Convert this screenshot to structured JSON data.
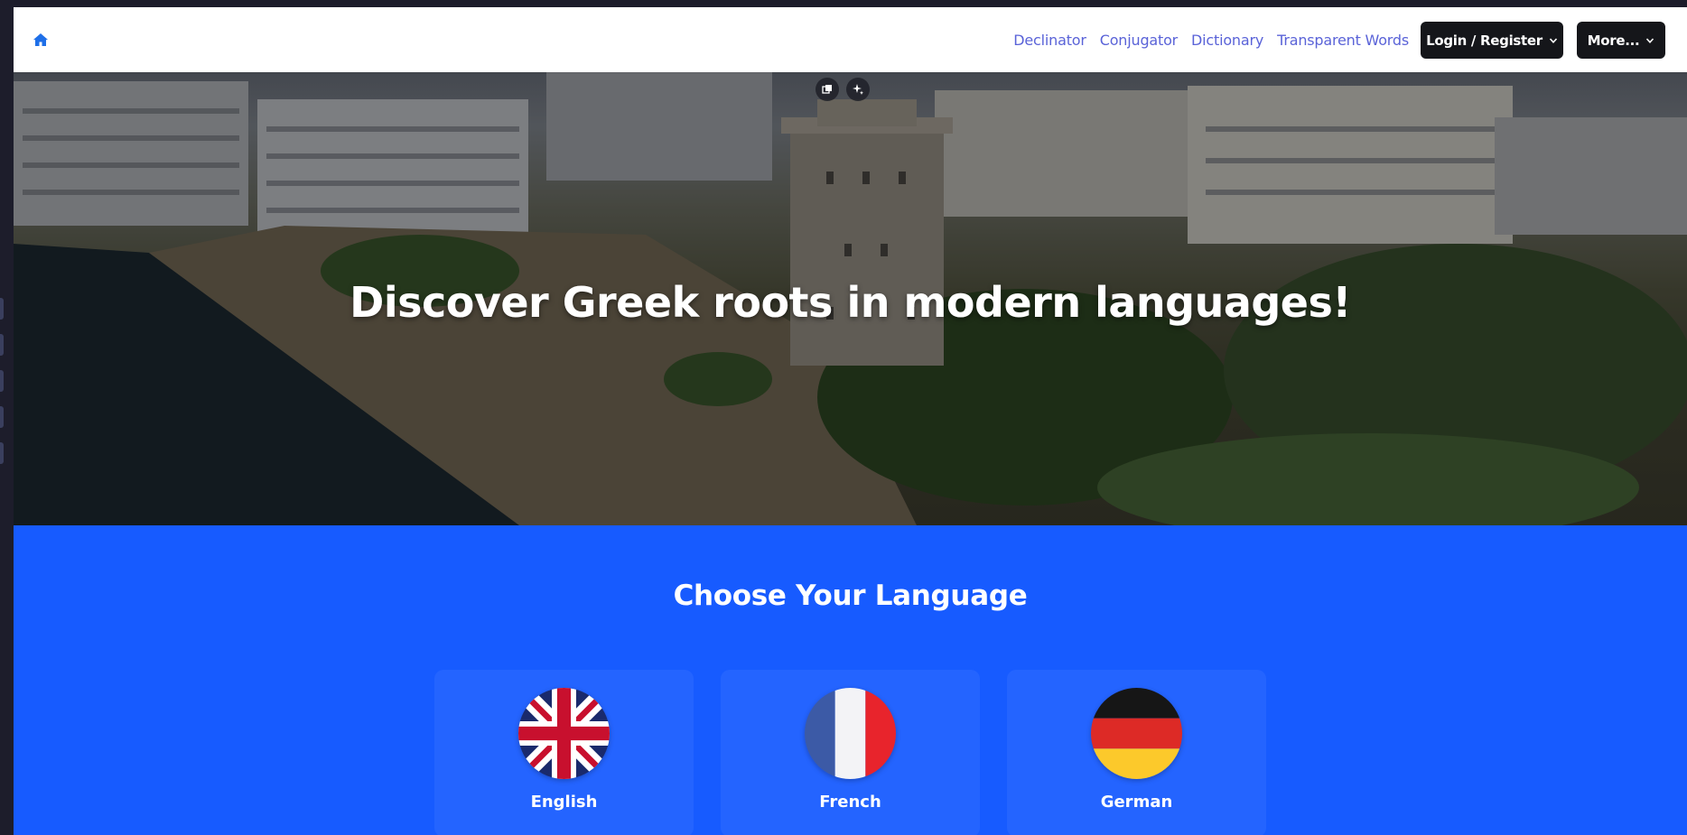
{
  "nav": {
    "home_icon": "home-icon",
    "links": [
      "Declinator",
      "Conjugator",
      "Dictionary",
      "Transparent Words"
    ],
    "login_label": "Login / Register",
    "more_label": "More...",
    "link_color": "#5a63d8",
    "button_color": "#15161a"
  },
  "hero": {
    "title": "Discover Greek roots in modern languages!",
    "tools": [
      "copy-image-icon",
      "sparkle-icon"
    ]
  },
  "languages": {
    "heading": "Choose Your Language",
    "background": "#175bff",
    "items": [
      {
        "name": "English",
        "flag": "uk-flag-icon"
      },
      {
        "name": "French",
        "flag": "france-flag-icon"
      },
      {
        "name": "German",
        "flag": "germany-flag-icon"
      }
    ]
  }
}
